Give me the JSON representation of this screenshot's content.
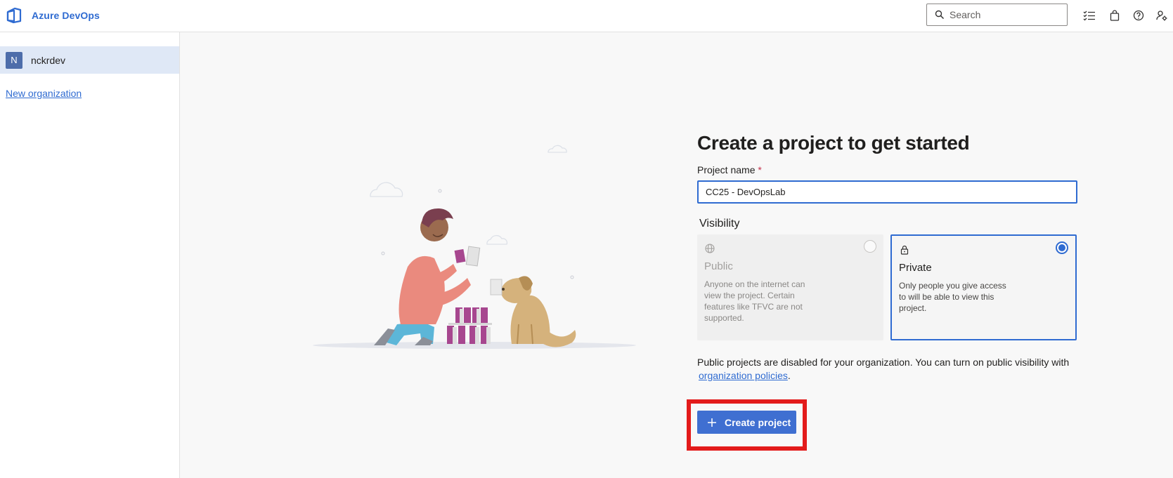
{
  "header": {
    "brand": "Azure DevOps",
    "search_placeholder": "Search",
    "icons": [
      "azure-devops-logo-icon",
      "search-icon",
      "task-list-icon",
      "shopping-bag-icon",
      "help-icon",
      "user-settings-icon"
    ]
  },
  "sidebar": {
    "organizations": [
      {
        "initial": "N",
        "name": "nckrdev",
        "selected": true
      }
    ],
    "new_org_label": "New organization"
  },
  "form": {
    "title": "Create a project to get started",
    "project_name_label": "Project name",
    "required_marker": "*",
    "project_name_value": "CC25 - DevOpsLab",
    "visibility_label": "Visibility",
    "options": [
      {
        "title": "Public",
        "description": "Anyone on the internet can view the project. Certain features like TFVC are not supported.",
        "selected": false,
        "disabled": true,
        "icon": "globe-icon"
      },
      {
        "title": "Private",
        "description": "Only people you give access to will be able to view this project.",
        "selected": true,
        "disabled": false,
        "icon": "lock-icon"
      }
    ],
    "notice_text": "Public projects are disabled for your organization. You can turn on public visibility with",
    "notice_link": "organization policies",
    "notice_end": ".",
    "create_button_label": "Create project"
  },
  "colors": {
    "accent": "#2f6bd1",
    "button": "#3f6fd1",
    "highlight": "#e31b1b",
    "selected_nav": "#dfe8f6"
  }
}
